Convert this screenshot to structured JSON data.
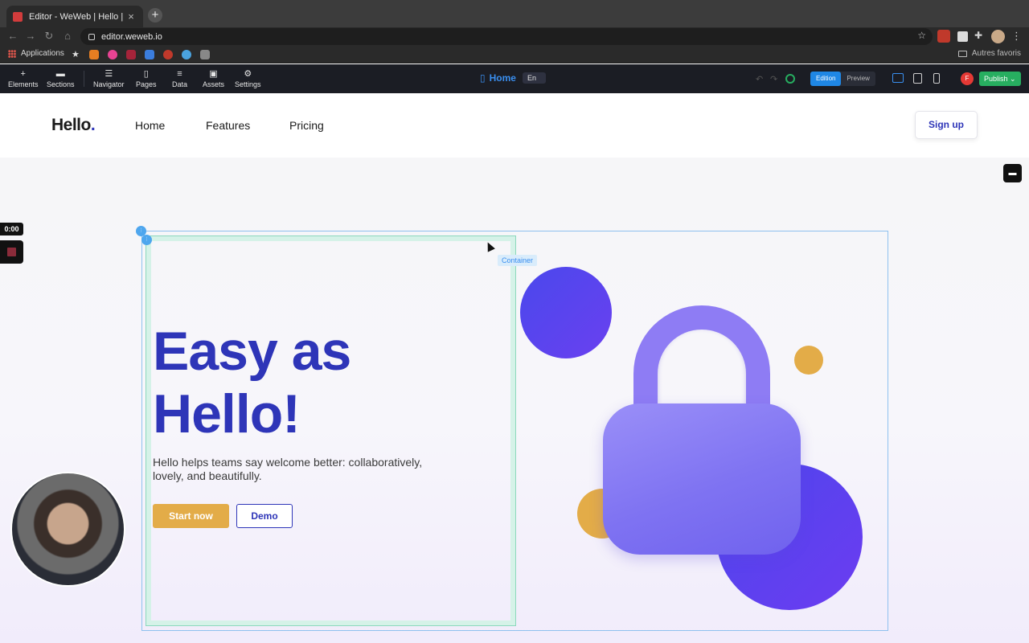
{
  "browser": {
    "tab_title": "Editor - WeWeb | Hello | Easy as Hello!",
    "tab_close": "×",
    "new_tab": "+",
    "url": "editor.weweb.io",
    "bookmarks": {
      "apps_label": "Applications",
      "other_label": "Autres favoris"
    }
  },
  "editor": {
    "tools": [
      {
        "label": "Elements",
        "icon": "plus-icon"
      },
      {
        "label": "Sections",
        "icon": "sections-icon"
      },
      {
        "label": "Navigator",
        "icon": "list-icon"
      },
      {
        "label": "Pages",
        "icon": "document-icon"
      },
      {
        "label": "Data",
        "icon": "database-icon"
      },
      {
        "label": "Assets",
        "icon": "image-icon"
      },
      {
        "label": "Settings",
        "icon": "gear-icon"
      }
    ],
    "page_name": "Home",
    "language": "En",
    "modes": {
      "edition": "Edition",
      "preview": "Preview"
    },
    "user_initial": "F",
    "publish_label": "Publish"
  },
  "site": {
    "logo": "Hello",
    "logo_dot": ".",
    "nav": [
      "Home",
      "Features",
      "Pricing"
    ],
    "signup": "Sign up",
    "hero": {
      "title_line1": "Easy as",
      "title_line2": "Hello!",
      "subtitle": "Hello helps teams say welcome better: collaboratively, lovely, and beautifully.",
      "primary_cta": "Start now",
      "secondary_cta": "Demo"
    },
    "container_tag": "Container"
  },
  "recorder": {
    "timer": "0:00"
  },
  "colors": {
    "brand": "#2e35b8",
    "accent": "#e3ac48",
    "editor_blue": "#1f87e5",
    "publish_green": "#27ae60"
  }
}
